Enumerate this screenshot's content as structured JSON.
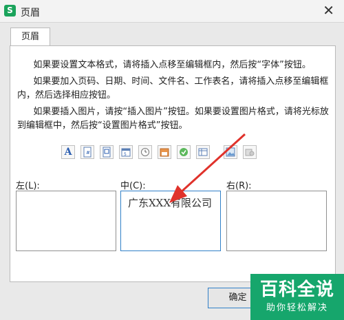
{
  "window": {
    "title": "页眉",
    "app_icon_letter": "S"
  },
  "tab": {
    "label": "页眉"
  },
  "instructions": [
    "如果要设置文本格式，请将插入点移至编辑框内，然后按“字体”按钮。",
    "如果要加入页码、日期、时间、文件名、工作表名，请将插入点移至编辑框内，然后选择相应按钮。",
    "如果要插入图片，请按“插入图片”按钮。如果要设置图片格式，请将光标放到编辑框中，然后按“设置图片格式”按钮。"
  ],
  "toolbar": {
    "font_letter": "A",
    "icons": [
      "font-icon",
      "page-number-icon",
      "total-pages-icon",
      "date-icon",
      "time-icon",
      "file-path-icon",
      "file-name-icon",
      "sheet-name-icon",
      "insert-picture-icon",
      "format-picture-icon"
    ]
  },
  "sections": {
    "left": {
      "label": "左(L):",
      "text": ""
    },
    "center": {
      "label": "中(C):",
      "text": "广东XXX有限公司"
    },
    "right": {
      "label": "右(R):",
      "text": ""
    }
  },
  "buttons": {
    "ok": "确定"
  },
  "watermark": {
    "main": "百科全说",
    "sub": "助你轻松解决"
  },
  "colors": {
    "accent": "#2f7fc7",
    "arrow": "#e0322b",
    "watermark": "#16a66c",
    "app_icon": "#1aa35b"
  }
}
